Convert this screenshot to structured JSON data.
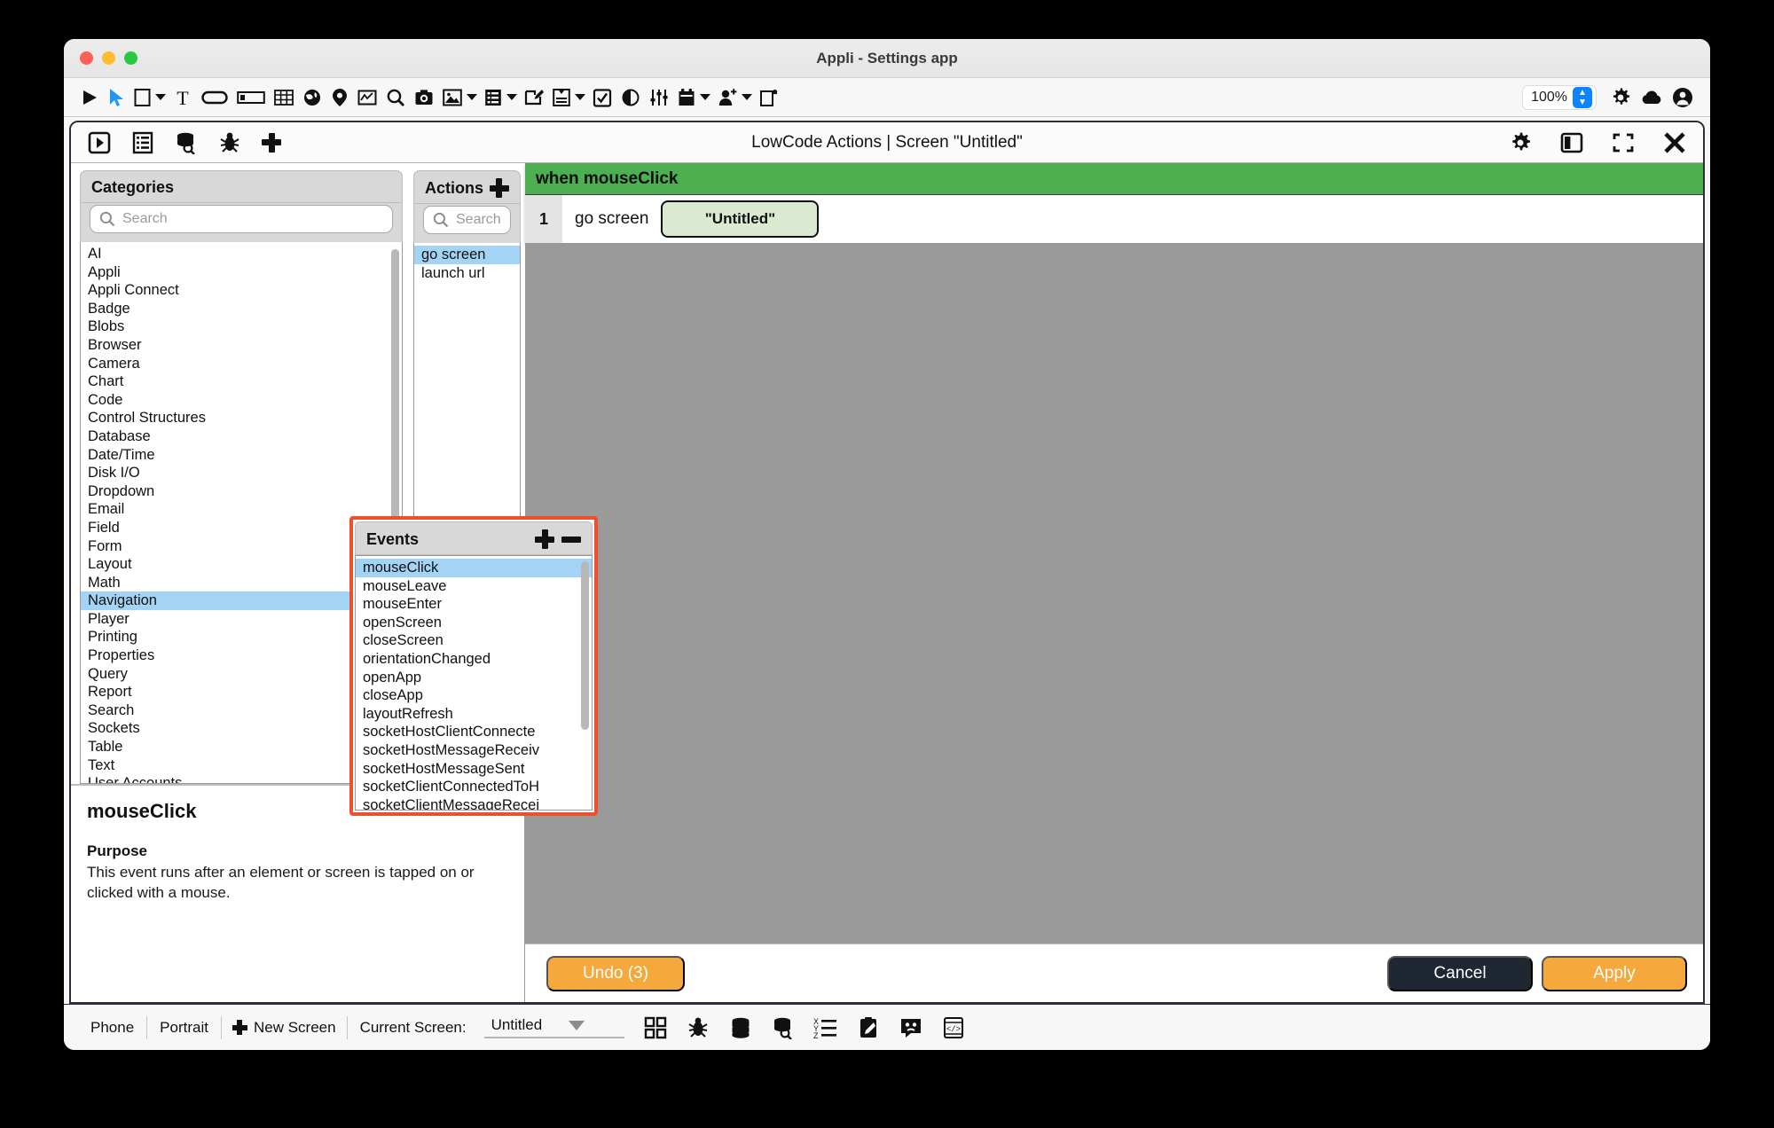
{
  "window": {
    "title": "Appli - Settings app"
  },
  "toolbar": {
    "items": [
      {
        "name": "play-icon",
        "caret": false
      },
      {
        "name": "pointer-icon",
        "caret": false
      },
      {
        "name": "rectangle-shape-icon",
        "caret": true
      },
      {
        "name": "text-icon",
        "caret": false
      },
      {
        "name": "button-icon",
        "caret": false
      },
      {
        "name": "input-field-icon",
        "caret": false
      },
      {
        "name": "table-grid-icon",
        "caret": false
      },
      {
        "name": "web-globe-icon",
        "caret": false
      },
      {
        "name": "map-pin-icon",
        "caret": false
      },
      {
        "name": "chart-icon",
        "caret": false
      },
      {
        "name": "search-icon",
        "caret": false
      },
      {
        "name": "camera-icon",
        "caret": false
      },
      {
        "name": "image-icon",
        "caret": true
      },
      {
        "name": "list-view-icon",
        "caret": true
      },
      {
        "name": "signature-edit-icon",
        "caret": false
      },
      {
        "name": "form-icon",
        "caret": true
      },
      {
        "name": "checkbox-icon",
        "caret": false
      },
      {
        "name": "toggle-switch-icon",
        "caret": false
      },
      {
        "name": "sliders-icon",
        "caret": false
      },
      {
        "name": "calendar-icon",
        "caret": true
      },
      {
        "name": "add-user-icon",
        "caret": true
      },
      {
        "name": "copy-page-icon",
        "caret": false
      }
    ],
    "zoom_value": "100%",
    "right_icons": [
      {
        "name": "gear-icon"
      },
      {
        "name": "cloud-upload-icon"
      },
      {
        "name": "account-icon"
      }
    ]
  },
  "lowcode": {
    "title": "LowCode Actions | Screen \"Untitled\"",
    "left_icons": [
      {
        "name": "play-boxed-icon"
      },
      {
        "name": "list-document-icon"
      },
      {
        "name": "database-search-icon"
      },
      {
        "name": "debug-bug-icon"
      },
      {
        "name": "add-plus-icon"
      }
    ],
    "right_icons": [
      {
        "name": "settings-gear-icon"
      },
      {
        "name": "split-view-icon"
      },
      {
        "name": "fullscreen-icon"
      },
      {
        "name": "close-icon"
      }
    ]
  },
  "categories": {
    "title": "Categories",
    "search_placeholder": "Search",
    "search_value": "",
    "selected": "Navigation",
    "items": [
      "AI",
      "Appli",
      "Appli Connect",
      "Badge",
      "Blobs",
      "Browser",
      "Camera",
      "Chart",
      "Code",
      "Control Structures",
      "Database",
      "Date/Time",
      "Disk I/O",
      "Dropdown",
      "Email",
      "Field",
      "Form",
      "Layout",
      "Math",
      "Navigation",
      "Player",
      "Printing",
      "Properties",
      "Query",
      "Report",
      "Search",
      "Sockets",
      "Table",
      "Text",
      "User Accounts"
    ]
  },
  "actions": {
    "title": "Actions",
    "search_placeholder": "Search",
    "search_value": "",
    "selected": "go screen",
    "items": [
      "go screen",
      "launch url"
    ]
  },
  "events": {
    "title": "Events",
    "selected": "mouseClick",
    "items": [
      "mouseClick",
      "mouseLeave",
      "mouseEnter",
      "openScreen",
      "closeScreen",
      "orientationChanged",
      "openApp",
      "closeApp",
      "layoutRefresh",
      "socketHostClientConnecte",
      "socketHostMessageReceiv",
      "socketHostMessageSent",
      "socketClientConnectedToH",
      "socketClientMessageRecei"
    ]
  },
  "description": {
    "title": "mouseClick",
    "section_label": "Purpose",
    "body": "This event runs after an element or screen is tapped on or clicked with a mouse."
  },
  "script": {
    "when_label": "when mouseClick",
    "steps": [
      {
        "number": "1",
        "verb": "go screen",
        "param": "\"Untitled\""
      }
    ]
  },
  "footer": {
    "undo_label": "Undo (3)",
    "cancel_label": "Cancel",
    "apply_label": "Apply"
  },
  "statusbar": {
    "device": "Phone",
    "orientation": "Portrait",
    "new_screen_label": "New Screen",
    "current_screen_label": "Current Screen:",
    "current_screen_value": "Untitled",
    "icons": [
      {
        "name": "grid-layout-icon"
      },
      {
        "name": "debug-bug-icon"
      },
      {
        "name": "database-icon"
      },
      {
        "name": "database-search-icon"
      },
      {
        "name": "variables-list-icon"
      },
      {
        "name": "clipboard-edit-icon"
      },
      {
        "name": "chat-bubble-icon"
      },
      {
        "name": "device-code-icon"
      }
    ]
  },
  "colors": {
    "accent_orange": "#f5a93c",
    "event_green": "#4caf50",
    "selection_blue": "#a4d4f5",
    "highlight_red": "#ef4f2b",
    "cancel_dark": "#1f2733"
  }
}
